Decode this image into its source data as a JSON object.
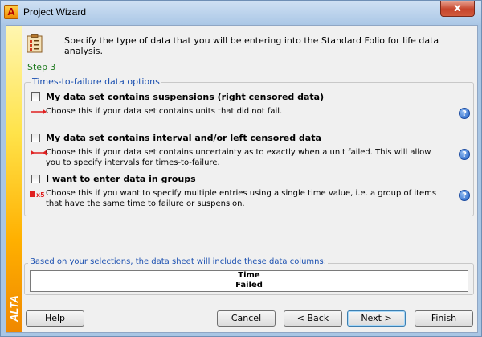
{
  "window": {
    "title": "Project Wizard",
    "app_icon_letter": "A",
    "close_glyph": "x"
  },
  "sidebar": {
    "brand": "ALTA",
    "gradient": [
      "#fff6b0",
      "#ffb000",
      "#f08800"
    ]
  },
  "header": {
    "description": "Specify the type of data that you will be entering into the Standard Folio for life data analysis.",
    "step": "Step 3",
    "icon": "wizard-clipboard-icon"
  },
  "options_group": {
    "title": "Times-to-failure data options",
    "options": [
      {
        "label": "My data set contains suspensions (right censored data)",
        "description": "Choose this if your data set contains units that did not fail.",
        "checked": false,
        "glyph": "red-arrow-icon"
      },
      {
        "label": "My data set contains interval and/or left censored data",
        "description": "Choose this if your data set contains uncertainty as to exactly when a unit failed. This will allow you to specify intervals for times-to-failure.",
        "checked": false,
        "glyph": "red-interval-icon"
      },
      {
        "label": "I want to enter data in groups",
        "description": "Choose this if you want to specify multiple entries using a single time value, i.e. a group of items that have the same time to failure or suspension.",
        "checked": false,
        "glyph": "red-group-icon",
        "glyph_text": "x5"
      }
    ],
    "help_glyph": "?"
  },
  "columns_group": {
    "title": "Based on your selections, the data sheet will include these data columns:",
    "columns": [
      "Time",
      "Failed"
    ]
  },
  "buttons": {
    "help": "Help",
    "cancel": "Cancel",
    "back": "< Back",
    "next": "Next >",
    "finish": "Finish"
  },
  "colors": {
    "accent_blue": "#1a4fb0",
    "step_green": "#1e7a1e",
    "glyph_red": "#e02020"
  }
}
